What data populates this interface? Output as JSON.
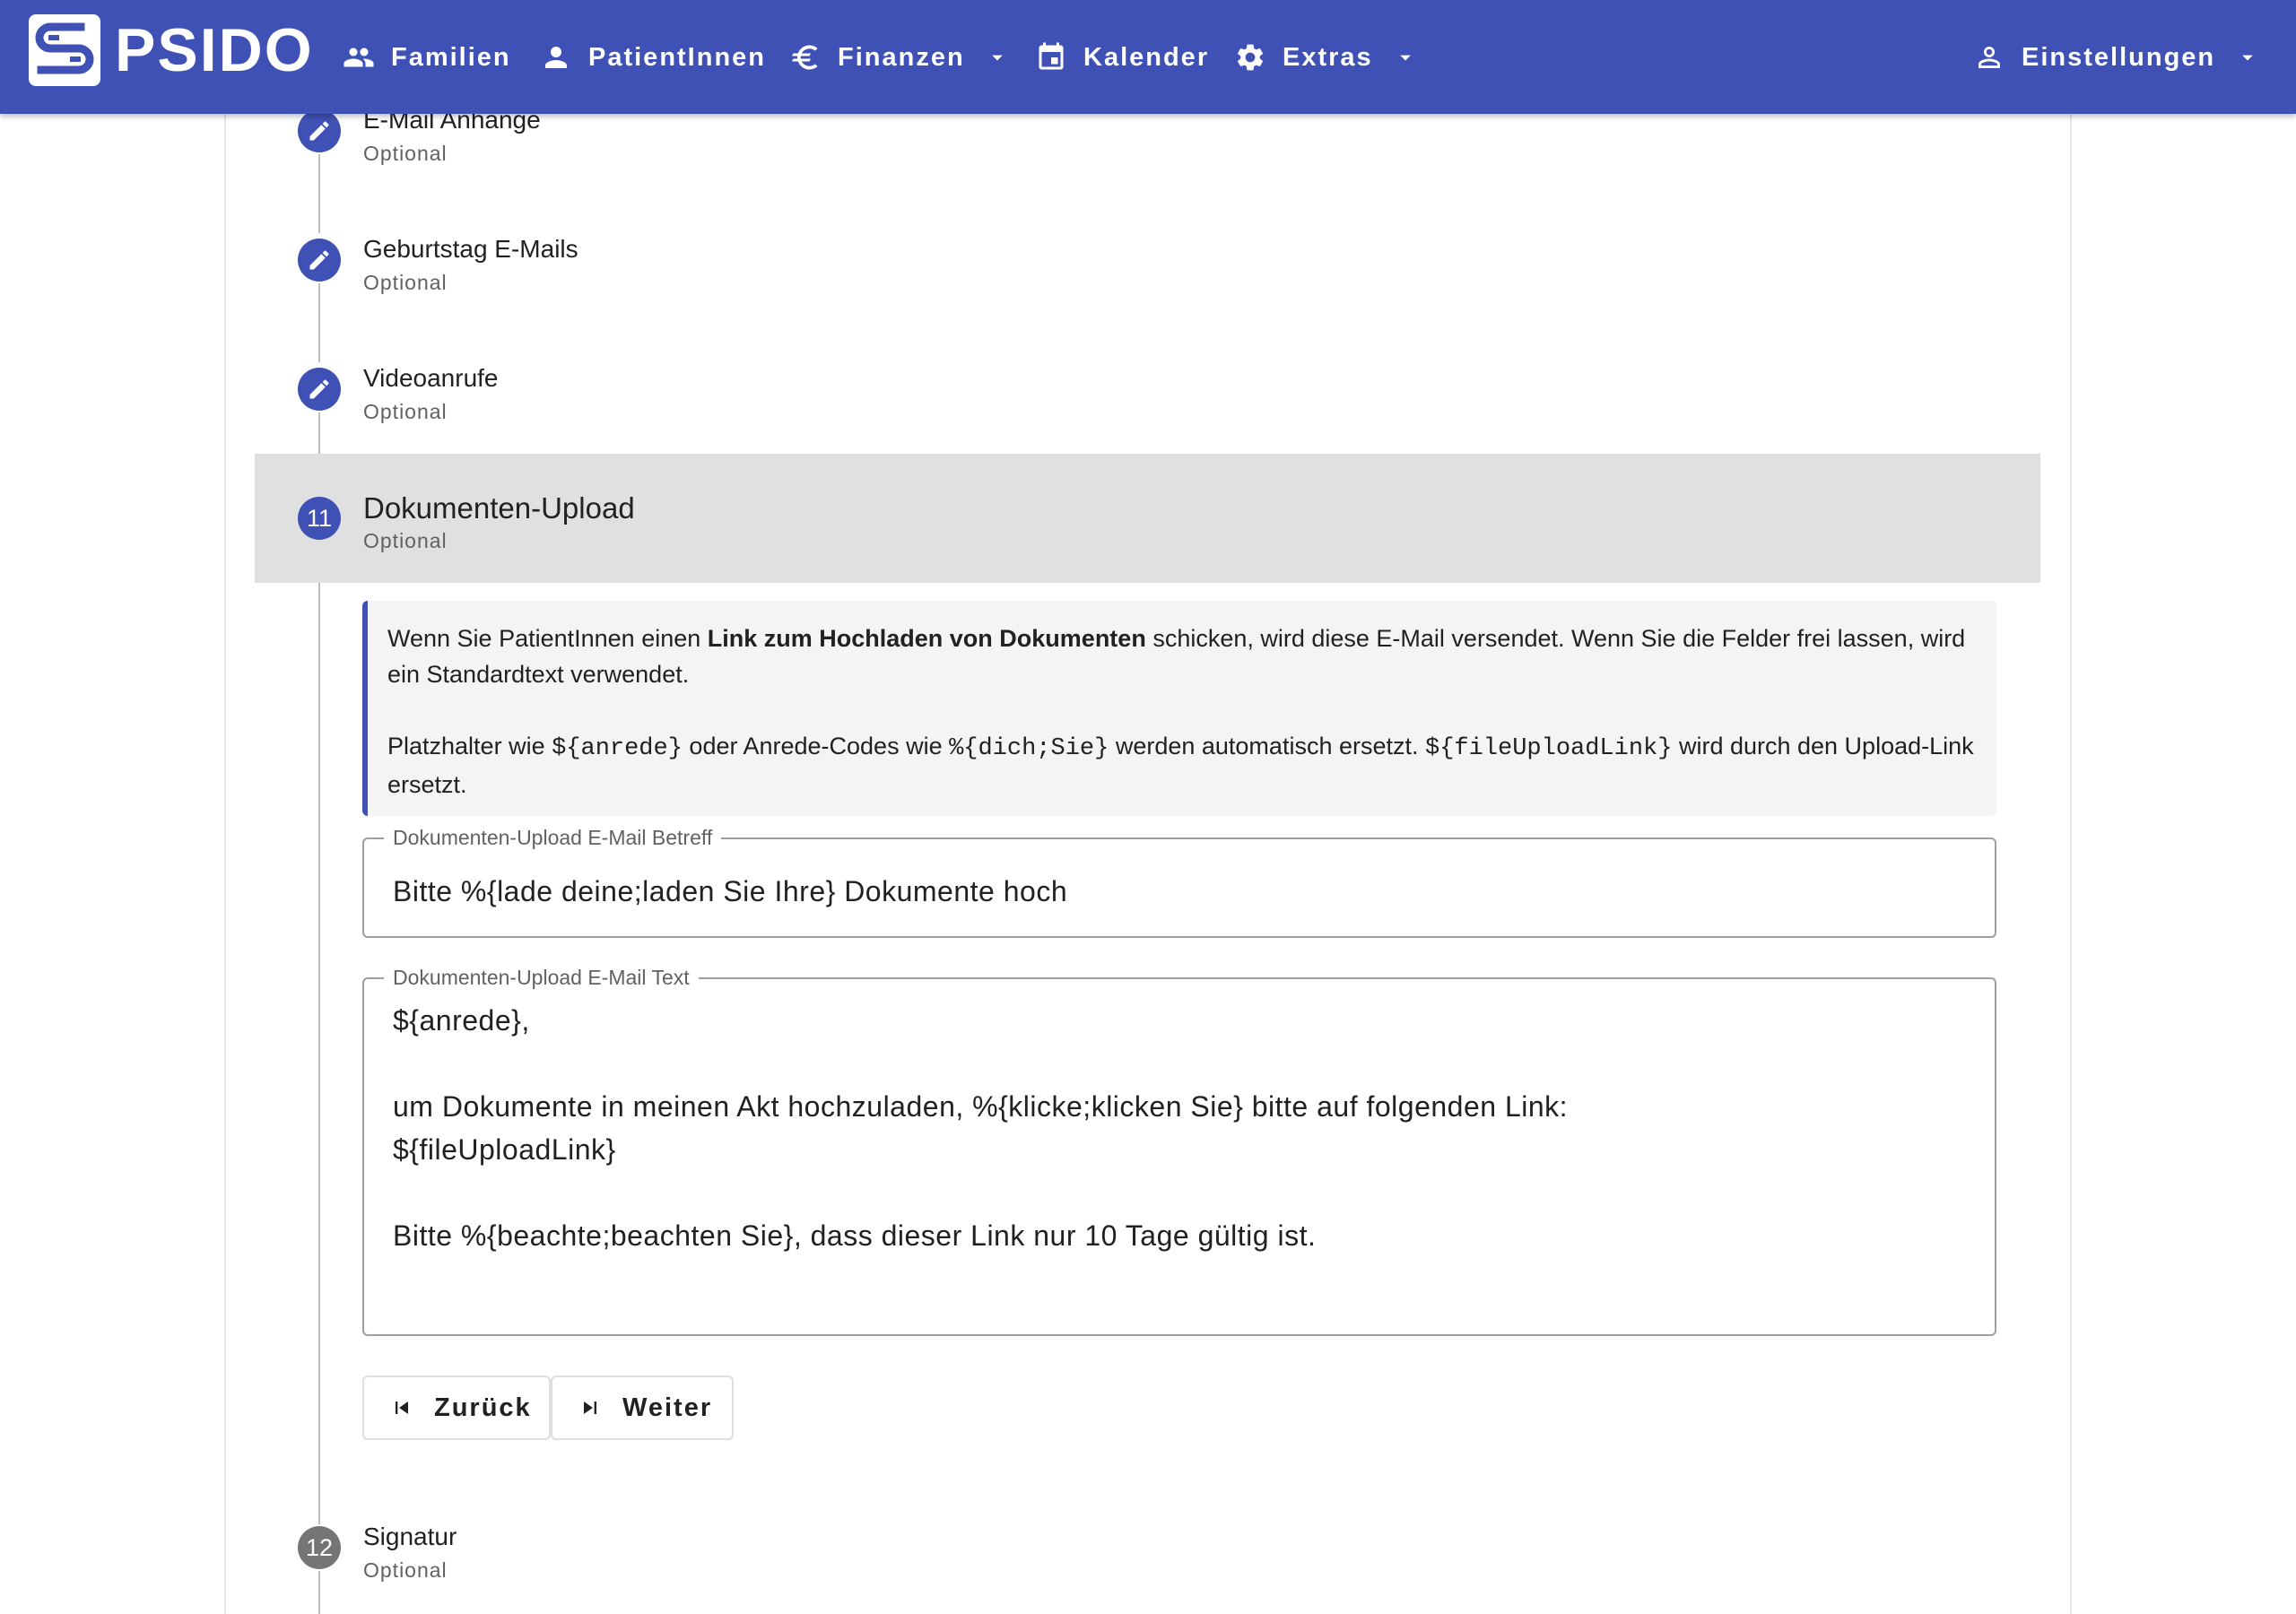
{
  "app": {
    "logo_text": "PSIDO",
    "brand_color": "#3f51b5"
  },
  "nav": {
    "items": [
      {
        "label": "Familien",
        "icon": "people-icon"
      },
      {
        "label": "PatientInnen",
        "icon": "person-icon"
      },
      {
        "label": "Finanzen",
        "icon": "euro-icon",
        "dropdown": true
      },
      {
        "label": "Kalender",
        "icon": "calendar-icon"
      },
      {
        "label": "Extras",
        "icon": "gear-icon",
        "dropdown": true
      }
    ],
    "settings": {
      "label": "Einstellungen",
      "icon": "person-outline-icon",
      "dropdown": true
    }
  },
  "steps": [
    {
      "title": "E-Mail Anhänge",
      "subtitle": "Optional",
      "icon": "edit-icon",
      "state": "edited"
    },
    {
      "title": "Geburtstag E-Mails",
      "subtitle": "Optional",
      "icon": "edit-icon",
      "state": "edited"
    },
    {
      "title": "Videoanrufe",
      "subtitle": "Optional",
      "icon": "edit-icon",
      "state": "edited"
    },
    {
      "number": "11",
      "title": "Dokumenten-Upload",
      "subtitle": "Optional",
      "state": "active"
    },
    {
      "number": "12",
      "title": "Signatur",
      "subtitle": "Optional",
      "state": "inactive"
    }
  ],
  "info": {
    "p1_before": "Wenn Sie PatientInnen einen ",
    "p1_bold": "Link zum Hochladen von Dokumenten",
    "p1_after": " schicken, wird diese E-Mail versendet. Wenn Sie die Felder frei lassen, wird ein Standardtext verwendet.",
    "p2_a": "Platzhalter wie ",
    "p2_code1": "${anrede}",
    "p2_b": " oder Anrede-Codes wie ",
    "p2_code2": "%{dich;Sie}",
    "p2_c": " werden automatisch ersetzt. ",
    "p2_code3": "${fileUploadLink}",
    "p2_d": " wird durch den Upload-Link ersetzt."
  },
  "subject_field": {
    "label": "Dokumenten-Upload E-Mail Betreff",
    "value": "Bitte %{lade deine;laden Sie Ihre} Dokumente hoch"
  },
  "text_field": {
    "label": "Dokumenten-Upload E-Mail Text",
    "value": "${anrede},\n\num Dokumente in meinen Akt hochzuladen, %{klicke;klicken Sie} bitte auf folgenden Link:\n${fileUploadLink}\n\nBitte %{beachte;beachten Sie}, dass dieser Link nur 10 Tage gültig ist."
  },
  "buttons": {
    "back": {
      "label": "Zurück",
      "icon": "skip-previous-icon"
    },
    "next": {
      "label": "Weiter",
      "icon": "skip-next-icon"
    }
  }
}
